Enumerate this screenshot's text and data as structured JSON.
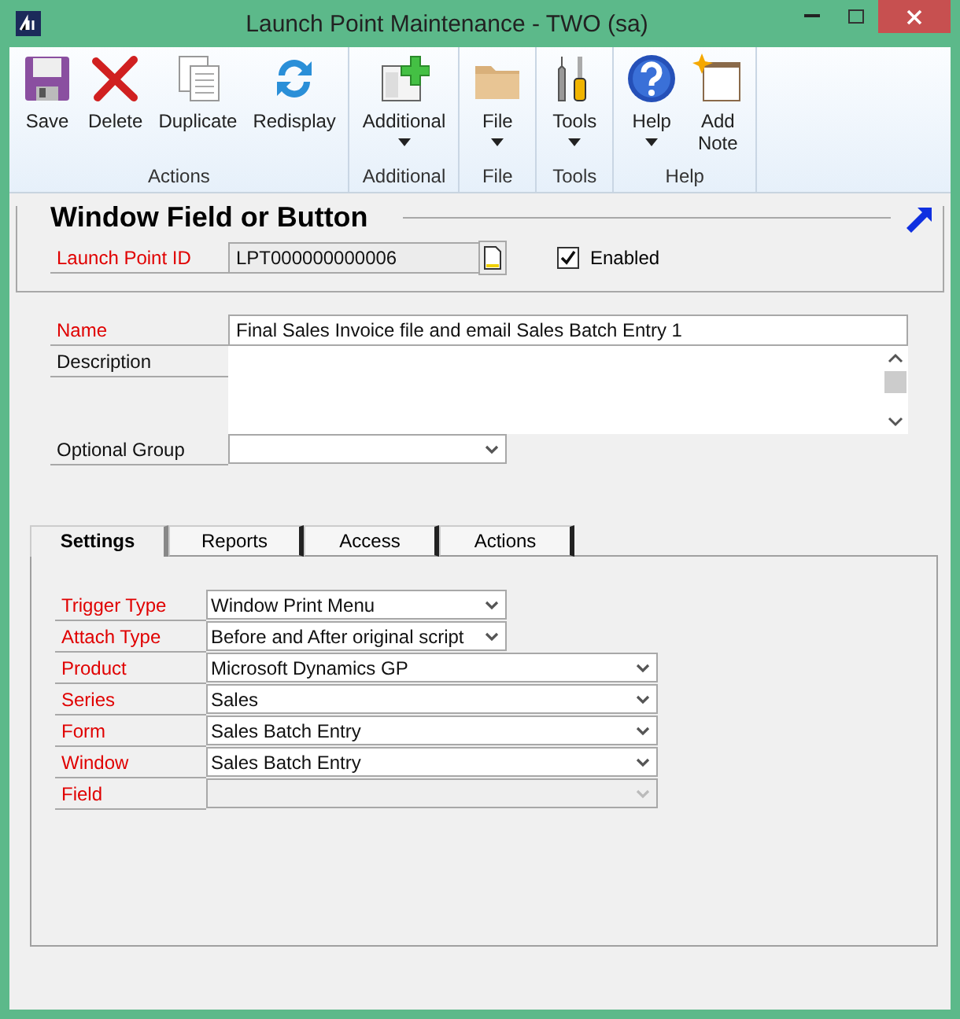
{
  "window": {
    "title": "Launch Point Maintenance  -  TWO (sa)"
  },
  "ribbon": {
    "groups": [
      {
        "label": "Actions",
        "buttons": [
          {
            "label": "Save",
            "dropdown": false
          },
          {
            "label": "Delete",
            "dropdown": false
          },
          {
            "label": "Duplicate",
            "dropdown": false
          },
          {
            "label": "Redisplay",
            "dropdown": false
          }
        ]
      },
      {
        "label": "Additional",
        "buttons": [
          {
            "label": "Additional",
            "dropdown": true
          }
        ]
      },
      {
        "label": "File",
        "buttons": [
          {
            "label": "File",
            "dropdown": true
          }
        ]
      },
      {
        "label": "Tools",
        "buttons": [
          {
            "label": "Tools",
            "dropdown": true
          }
        ]
      },
      {
        "label": "Help",
        "buttons": [
          {
            "label": "Help",
            "dropdown": true
          },
          {
            "label": "Add\nNote",
            "dropdown": false
          }
        ]
      }
    ]
  },
  "section": {
    "title": "Window Field or Button",
    "launch_point_id": {
      "label": "Launch Point  ID",
      "value": "LPT000000000006",
      "required": true
    },
    "enabled": {
      "label": "Enabled",
      "checked": true
    }
  },
  "fields": [
    {
      "label": "Name",
      "required": true,
      "kind": "text",
      "value": "Final Sales Invoice file and email Sales Batch Entry 1"
    },
    {
      "label": "Description",
      "required": false,
      "kind": "textarea"
    },
    {
      "label": "Optional Group",
      "required": false,
      "kind": "dropdown"
    }
  ],
  "tabs": [
    {
      "label": "Settings",
      "selected": true
    },
    {
      "label": "Reports",
      "selected": false
    },
    {
      "label": "Access",
      "selected": false
    },
    {
      "label": "Actions",
      "selected": false
    }
  ],
  "settings": [
    {
      "label": "Trigger Type",
      "required": true,
      "value": "Window Print Menu",
      "wide": false,
      "disabled": false
    },
    {
      "label": "Attach Type",
      "required": true,
      "value": "Before and After original script",
      "wide": false,
      "disabled": false
    },
    {
      "label": "Product",
      "required": true,
      "value": "Microsoft Dynamics GP",
      "wide": true,
      "disabled": false
    },
    {
      "label": "Series",
      "required": true,
      "value": "Sales",
      "wide": true,
      "disabled": false
    },
    {
      "label": "Form",
      "required": true,
      "value": "Sales Batch Entry",
      "wide": true,
      "disabled": false
    },
    {
      "label": "Window",
      "required": true,
      "value": "Sales Batch Entry",
      "wide": true,
      "disabled": false
    },
    {
      "label": "Field",
      "required": true,
      "wide": true,
      "disabled": true
    }
  ]
}
